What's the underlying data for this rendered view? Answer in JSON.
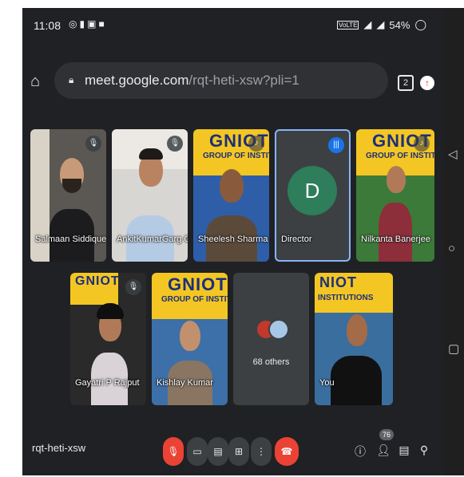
{
  "status_bar": {
    "time": "11:08",
    "left_icons": [
      "whatsapp-icon",
      "notification-icon",
      "gallery-icon",
      "video-icon"
    ],
    "network_label": "VoLTE",
    "battery": "54%"
  },
  "address_bar": {
    "domain": "meet.google.com",
    "path": "/rqt-heti-xsw?pli=1",
    "tab_count": "2"
  },
  "tiles": [
    {
      "name": "Salmaan Siddique",
      "muted": true
    },
    {
      "name": "AnkitKumarGarg G",
      "muted": true
    },
    {
      "name": "Sheelesh Sharma",
      "muted": false
    },
    {
      "name": "Director",
      "initial": "D",
      "speaking": true
    },
    {
      "name": "Nilkanta Banerjee",
      "muted": false
    },
    {
      "name": "Gayatri P Rajput",
      "muted": true
    },
    {
      "name": "Kishlay Kumar",
      "muted": false
    },
    {
      "name": "68 others"
    },
    {
      "name": "You"
    }
  ],
  "banner": {
    "title": "GNIOT",
    "subtitle": "GROUP OF INSTITUTIONS",
    "mirrored_title": "NIOT",
    "mirrored_subtitle": "INSTITUTIONS"
  },
  "bottom_bar": {
    "meeting_code": "rqt-heti-xsw",
    "people_count": "76"
  },
  "colors": {
    "background": "#202124",
    "end_call": "#ea4335",
    "speaking": "#1a73e8",
    "director_avatar": "#2e7d5b"
  }
}
